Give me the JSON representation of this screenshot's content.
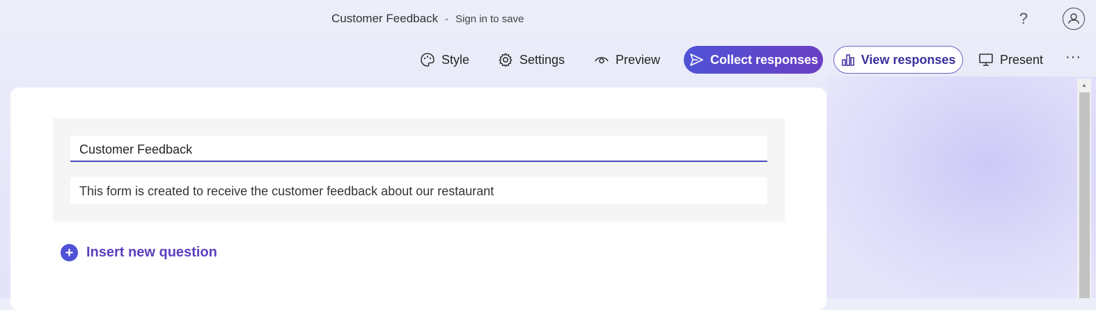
{
  "header": {
    "title": "Customer Feedback",
    "separator": "-",
    "sign_in_text": "Sign in to save",
    "help_label": "?",
    "avatar_icon": "person-icon"
  },
  "toolbar": {
    "style_label": "Style",
    "settings_label": "Settings",
    "preview_label": "Preview",
    "collect_label": "Collect responses",
    "view_label": "View responses",
    "present_label": "Present",
    "more_label": "···"
  },
  "form": {
    "title_value": "Customer Feedback",
    "description_value": "This form is created to receive the customer feedback about our restaurant",
    "insert_label": "Insert new question"
  },
  "colors": {
    "accent": "#4f52d6",
    "accent_end": "#6a3fc4",
    "insert_text": "#5b3fc0",
    "title_underline": "#4b48b8"
  },
  "icons": {
    "style": "palette-icon",
    "settings": "gear-icon",
    "preview": "eye-icon",
    "collect": "send-icon",
    "view": "bar-chart-icon",
    "present": "monitor-icon",
    "insert": "plus-circle-icon"
  }
}
